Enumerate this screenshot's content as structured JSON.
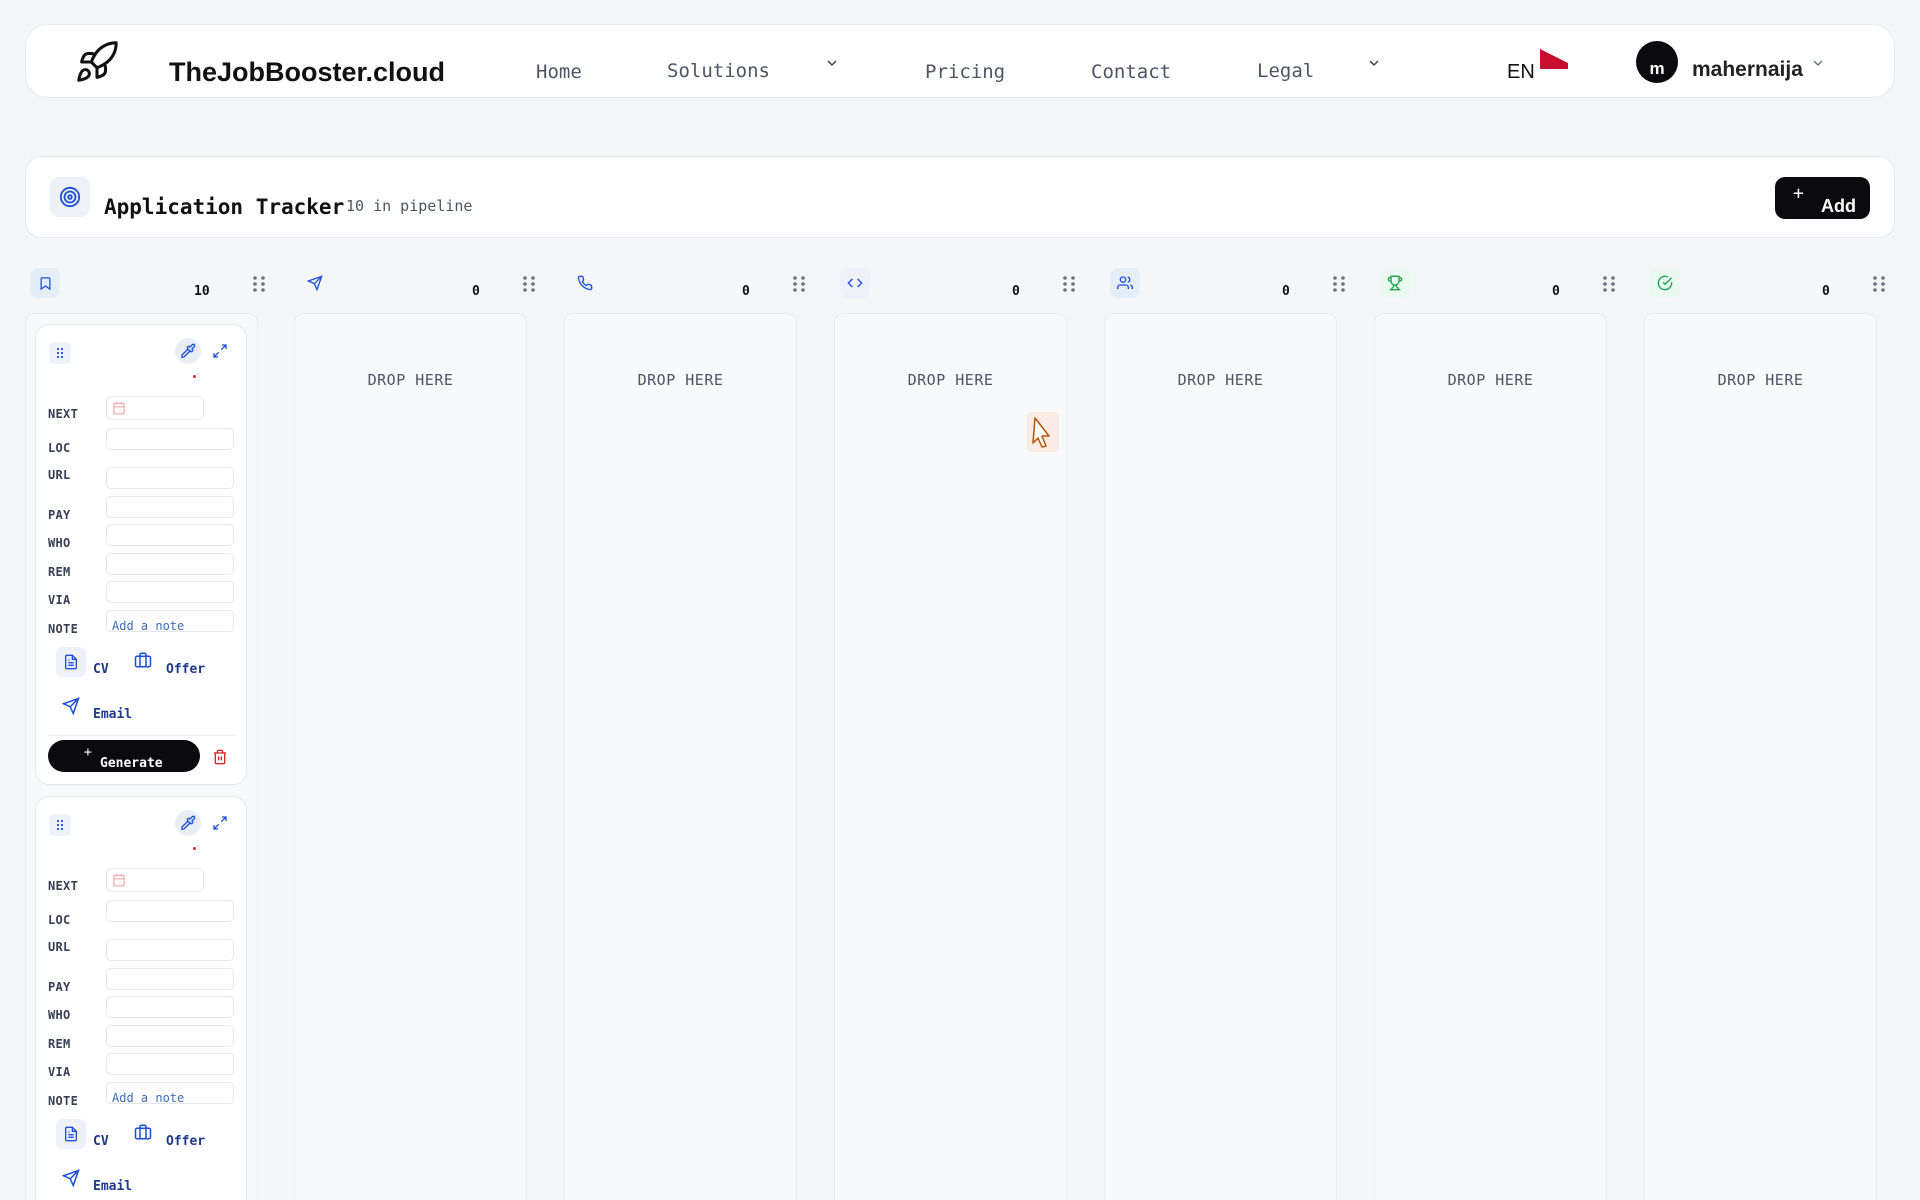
{
  "nav": {
    "brand": "TheJobBooster.cloud",
    "links": [
      {
        "label": "Home"
      },
      {
        "label": "Solutions"
      },
      {
        "label": "Pricing"
      },
      {
        "label": "Contact"
      },
      {
        "label": "Legal"
      }
    ],
    "language": "EN",
    "username": "mahernaija",
    "avatar_initial": "m"
  },
  "tracker": {
    "title": "Application Tracker",
    "pipeline_count": "10 in pipeline",
    "add_label": "Add"
  },
  "columns": [
    {
      "icon": "bookmark-icon",
      "count": "10",
      "drop": ""
    },
    {
      "icon": "send-icon",
      "count": "0",
      "drop": "DROP HERE"
    },
    {
      "icon": "phone-icon",
      "count": "0",
      "drop": "DROP HERE"
    },
    {
      "icon": "code-icon",
      "count": "0",
      "drop": "DROP HERE"
    },
    {
      "icon": "users-icon",
      "count": "0",
      "drop": "DROP HERE"
    },
    {
      "icon": "trophy-icon",
      "count": "0",
      "drop": "DROP HERE"
    },
    {
      "icon": "check-circle-icon",
      "count": "0",
      "drop": "DROP HERE"
    }
  ],
  "card": {
    "fields": {
      "next": "NEXT",
      "loc": "LOC",
      "url": "URL",
      "pay": "PAY",
      "who": "WHO",
      "rem": "REM",
      "via": "VIA",
      "note": "NOTE"
    },
    "note_placeholder": "Add a note",
    "docs": {
      "cv": "CV",
      "offer": "Offer",
      "email": "Email"
    },
    "generate_label": "Generate"
  },
  "colors": {
    "primary": "#0b0b0f",
    "accent_blue": "#3b6fb6",
    "danger": "#dc2626",
    "trophy_green": "#16a34a",
    "background": "#f5f6f8"
  }
}
